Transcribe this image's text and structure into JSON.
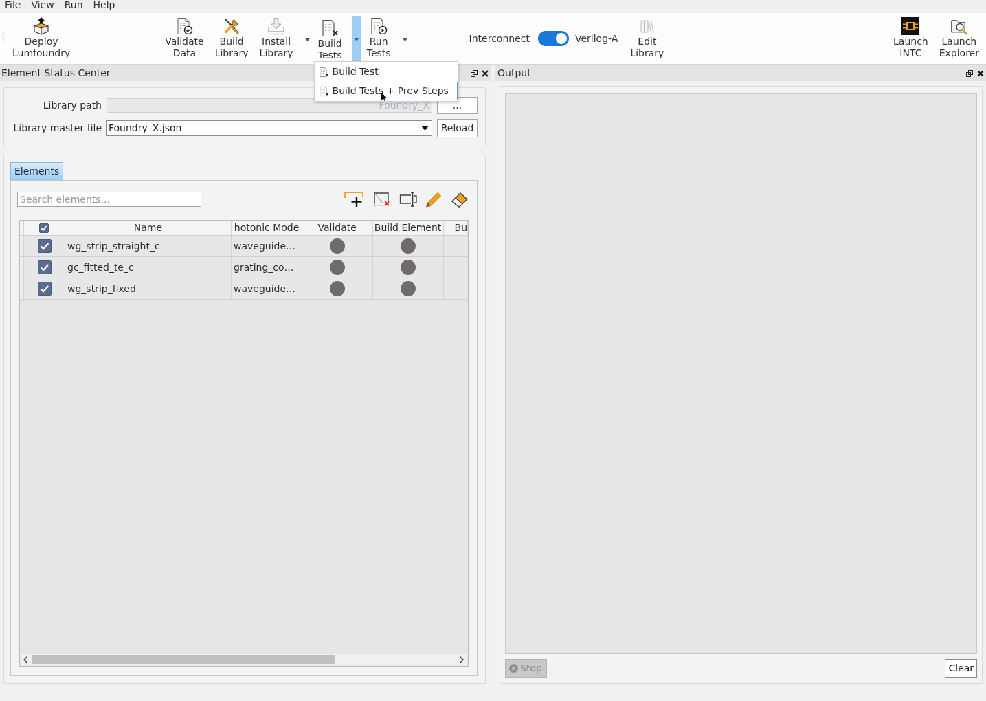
{
  "menu_bar": [
    {
      "label": "File"
    },
    {
      "label": "View"
    },
    {
      "label": "Run"
    },
    {
      "label": "Help"
    }
  ],
  "toolbar": {
    "left": [
      {
        "kind": "button",
        "label": [
          "Deploy",
          "Lumfoundry"
        ]
      }
    ],
    "center": [
      {
        "kind": "button",
        "label": [
          "Validate",
          "Data"
        ]
      },
      {
        "kind": "button",
        "label": [
          "Build",
          "Library"
        ]
      },
      {
        "kind": "dropdown",
        "label": [
          "Install",
          "Library"
        ],
        "open": false
      },
      {
        "kind": "dropdown",
        "label": [
          "Build",
          "Tests"
        ],
        "open": true,
        "menu": [
          {
            "label": "Build Test",
            "selected": false
          },
          {
            "label": "Build Tests + Prev Steps",
            "selected": true
          }
        ]
      },
      {
        "kind": "dropdown",
        "label": [
          "Run",
          "Tests"
        ],
        "open": false
      },
      {
        "kind": "toggle",
        "left_label": "Interconnect",
        "right_label": "Verilog-A",
        "on": true
      },
      {
        "kind": "button",
        "label": [
          "Edit",
          "Library"
        ]
      }
    ],
    "right": [
      {
        "kind": "button",
        "label": [
          "Launch",
          "INTC"
        ]
      },
      {
        "kind": "button",
        "label": [
          "Launch",
          "Explorer"
        ]
      }
    ]
  },
  "element_status_center": {
    "title": "Element Status Center",
    "library_path": {
      "label": "Library path",
      "value": "Foundry_X",
      "disabled": true,
      "button": "..."
    },
    "master_file": {
      "label": "Library master file",
      "value": "Foundry_X.json",
      "button": "Reload"
    },
    "tabs": [
      {
        "label": "Elements",
        "selected": true
      }
    ],
    "search": {
      "placeholder": "Search elements..."
    },
    "table": {
      "all_checked": true,
      "columns": [
        "Name",
        "hotonic Mode",
        "Validate",
        "Build Element",
        "Bu"
      ],
      "rows": [
        {
          "checked": true,
          "name": "wg_strip_straight_c",
          "photonic_mode": "waveguide…",
          "validate": {
            "color": "#6f6b6b"
          },
          "build_element": {
            "color": "#6f6b6b"
          }
        },
        {
          "checked": true,
          "name": "gc_fitted_te_c",
          "photonic_mode": "grating_co…",
          "validate": {
            "color": "#6f6b6b"
          },
          "build_element": {
            "color": "#6f6b6b"
          }
        },
        {
          "checked": true,
          "name": "wg_strip_fixed",
          "photonic_mode": "waveguide…",
          "validate": {
            "color": "#6f6b6b"
          },
          "build_element": {
            "color": "#6f6b6b"
          }
        }
      ]
    }
  },
  "output": {
    "title": "Output",
    "buttons": [
      {
        "kind": "icon",
        "label": "Stop",
        "disabled": true
      },
      {
        "kind": "text",
        "label": "Clear",
        "disabled": false
      }
    ]
  }
}
